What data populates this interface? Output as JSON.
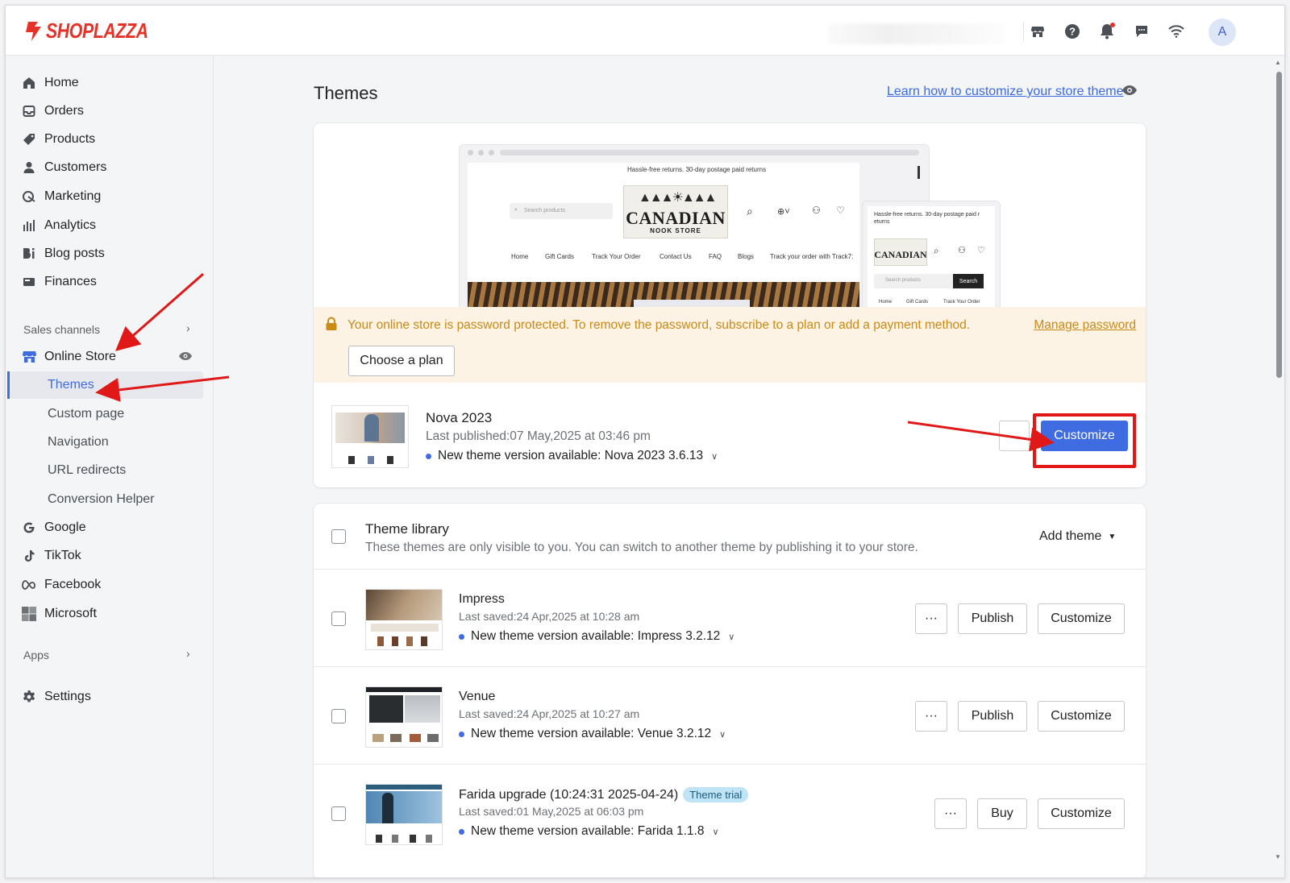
{
  "brand": {
    "name": "SHOPLAZZA",
    "color": "#e5332a"
  },
  "topbar": {
    "icons": [
      "store-icon",
      "help-icon",
      "bell-icon",
      "chat-icon",
      "wifi-icon"
    ],
    "avatar_initial": "A"
  },
  "sidebar": {
    "items": [
      {
        "label": "Home",
        "icon": "home-icon"
      },
      {
        "label": "Orders",
        "icon": "orders-icon"
      },
      {
        "label": "Products",
        "icon": "tag-icon"
      },
      {
        "label": "Customers",
        "icon": "person-icon"
      },
      {
        "label": "Marketing",
        "icon": "marketing-icon"
      },
      {
        "label": "Analytics",
        "icon": "bar-chart-icon"
      },
      {
        "label": "Blog posts",
        "icon": "blog-icon"
      },
      {
        "label": "Finances",
        "icon": "finance-icon"
      }
    ],
    "sales_channels_label": "Sales channels",
    "online_store_label": "Online Store",
    "sub_items": [
      "Themes",
      "Custom page",
      "Navigation",
      "URL redirects",
      "Conversion Helper"
    ],
    "channels": [
      {
        "label": "Google",
        "icon": "google-icon"
      },
      {
        "label": "TikTok",
        "icon": "tiktok-icon"
      },
      {
        "label": "Facebook",
        "icon": "meta-icon"
      },
      {
        "label": "Microsoft",
        "icon": "microsoft-icon"
      }
    ],
    "apps_label": "Apps",
    "settings_label": "Settings"
  },
  "main": {
    "title": "Themes",
    "help_link": "Learn how to customize your store theme",
    "preview": {
      "announcement": "Hassle-free returns. 30-day postage paid returns",
      "search_placeholder": "Search products",
      "logo_word": "CANADIAN",
      "logo_sub": "NOOK STORE",
      "nav": [
        "Home",
        "Gift Cards",
        "Track Your Order",
        "Contact Us",
        "FAQ",
        "Blogs",
        "Track your order with Track7:"
      ],
      "mobile_announcement": "Hassle-free returns. 30-day postage paid r eturns",
      "mobile_search_btn": "Search",
      "mobile_nav": [
        "Home",
        "Gift Cards",
        "Track Your Order"
      ]
    },
    "banner": {
      "text": "Your online store is password protected. To remove the password, subscribe to a plan or add a payment method.",
      "link": "Manage password",
      "button": "Choose a plan",
      "color": "#c98a16"
    },
    "current_theme": {
      "name": "Nova 2023",
      "published": "Last published:07 May,2025 at 03:46 pm",
      "version": "New theme version available: Nova 2023 3.6.13",
      "customize_label": "Customize",
      "accent": "#3f6ce0"
    },
    "library": {
      "title": "Theme library",
      "subtitle": "These themes are only visible to you. You can switch to another theme by publishing it to your store.",
      "add_theme_label": "Add theme",
      "themes": [
        {
          "name": "Impress",
          "saved": "Last saved:24 Apr,2025 at 10:28 am",
          "version": "New theme version available: Impress 3.2.12",
          "action": "Publish",
          "customize": "Customize",
          "badge": ""
        },
        {
          "name": "Venue",
          "saved": "Last saved:24 Apr,2025 at 10:27 am",
          "version": "New theme version available: Venue 3.2.12",
          "action": "Publish",
          "customize": "Customize",
          "badge": ""
        },
        {
          "name": "Farida upgrade (10:24:31 2025-04-24)",
          "saved": "Last saved:01 May,2025 at 06:03 pm",
          "version": "New theme version available: Farida 1.1.8",
          "action": "Buy",
          "customize": "Customize",
          "badge": "Theme trial"
        }
      ],
      "more_label": "···"
    }
  }
}
